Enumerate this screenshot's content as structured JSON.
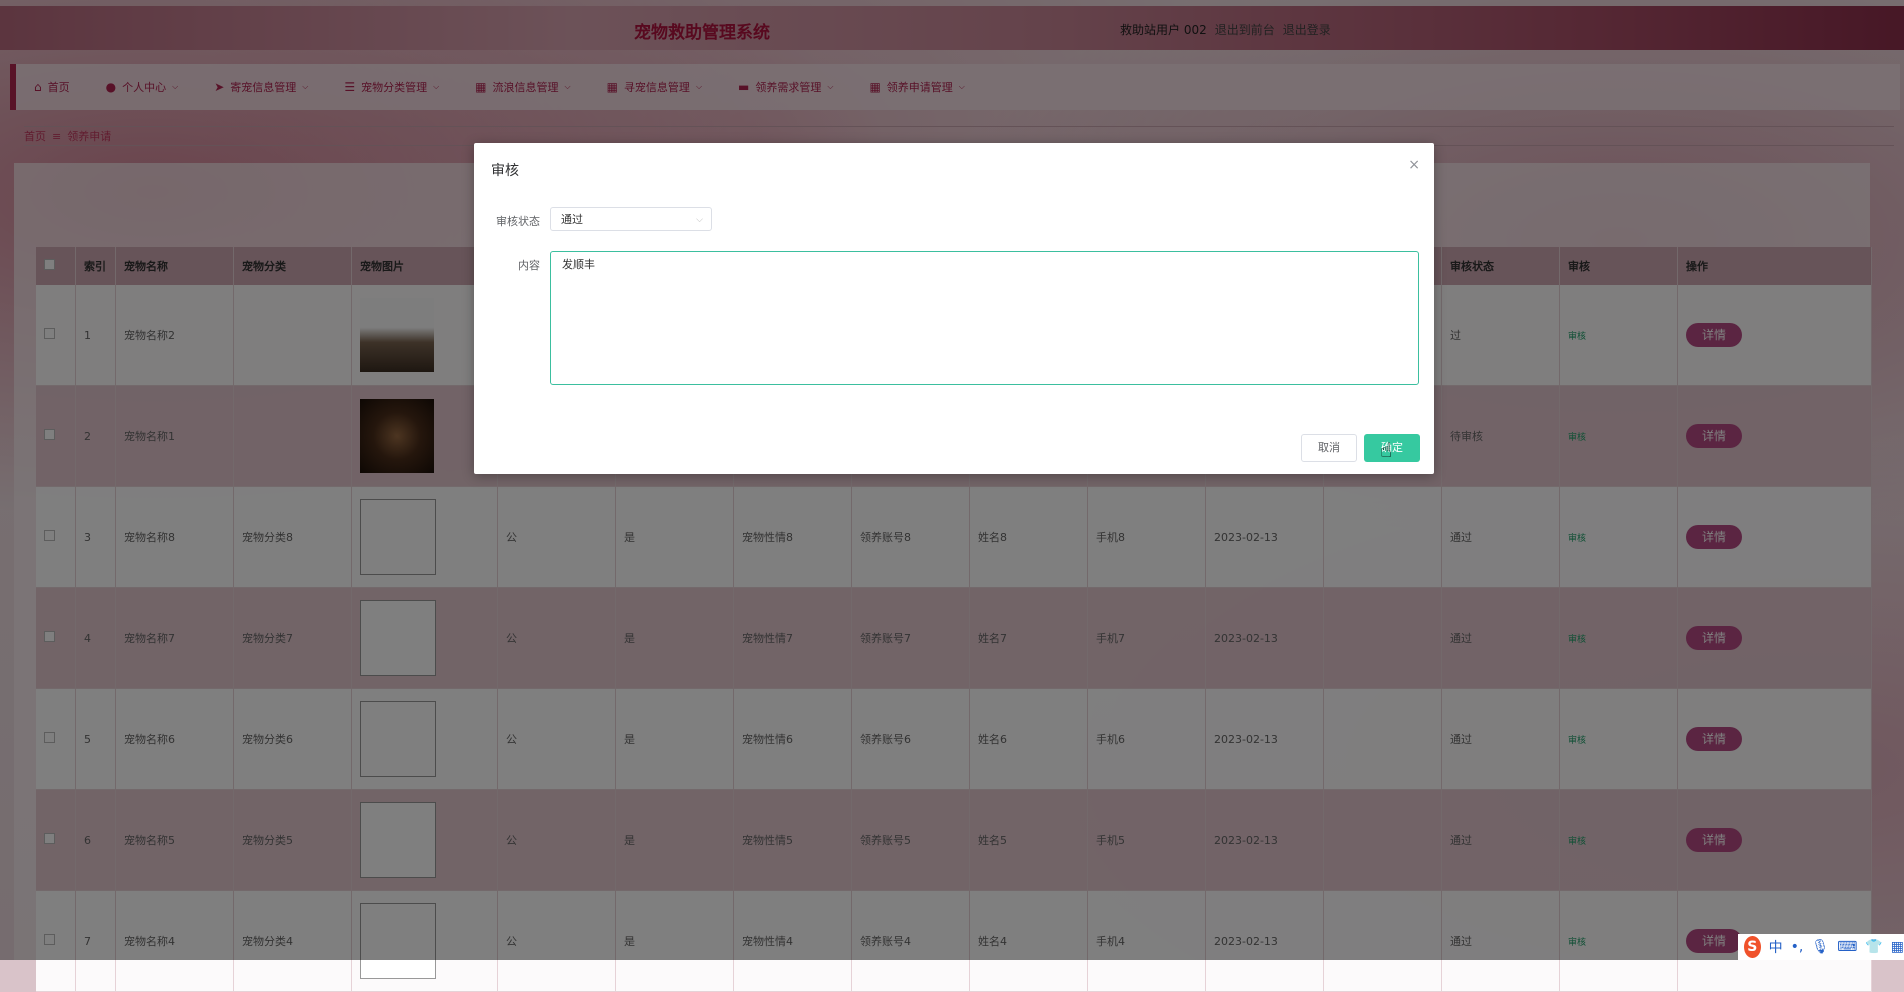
{
  "header": {
    "title": "宠物救助管理系统",
    "user": "救助站用户 002",
    "to_front": "退出到前台",
    "logout": "退出登录"
  },
  "nav": [
    {
      "label": "首页",
      "icon": "home-icon",
      "glyph": "⌂",
      "has_menu": false
    },
    {
      "label": "个人中心",
      "icon": "user-icon",
      "glyph": "●",
      "has_menu": true
    },
    {
      "label": "寄宠信息管理",
      "icon": "send-icon",
      "glyph": "➤",
      "has_menu": true
    },
    {
      "label": "宠物分类管理",
      "icon": "list-icon",
      "glyph": "☰",
      "has_menu": true
    },
    {
      "label": "流浪信息管理",
      "icon": "grid-icon",
      "glyph": "▦",
      "has_menu": true
    },
    {
      "label": "寻宠信息管理",
      "icon": "grid-icon",
      "glyph": "▦",
      "has_menu": true
    },
    {
      "label": "领养需求管理",
      "icon": "message-icon",
      "glyph": "▬",
      "has_menu": true
    },
    {
      "label": "领养申请管理",
      "icon": "grid-icon",
      "glyph": "▦",
      "has_menu": true
    }
  ],
  "breadcrumb": {
    "home": "首页",
    "current": "领养申请"
  },
  "table": {
    "headers": [
      "索引",
      "宠物名称",
      "宠物分类",
      "宠物图片",
      "审核状态",
      "审核",
      "操作"
    ],
    "rows": [
      {
        "index": "1",
        "name": "宠物名称2",
        "category": "",
        "gender": "",
        "vaccine": "",
        "character": "",
        "account": "",
        "realname": "",
        "phone": "",
        "date": "",
        "status": "过",
        "review": "审核",
        "action": "详情",
        "photo": "photo1"
      },
      {
        "index": "2",
        "name": "宠物名称1",
        "category": "",
        "gender": "",
        "vaccine": "",
        "character": "",
        "account": "",
        "realname": "",
        "phone": "",
        "date": "",
        "status": "待审核",
        "review": "审核",
        "action": "详情",
        "photo": "photo2"
      },
      {
        "index": "3",
        "name": "宠物名称8",
        "category": "宠物分类8",
        "gender": "公",
        "vaccine": "是",
        "character": "宠物性情8",
        "account": "领养账号8",
        "realname": "姓名8",
        "phone": "手机8",
        "date": "2023-02-13",
        "status": "通过",
        "review": "审核",
        "action": "详情",
        "photo": "broken"
      },
      {
        "index": "4",
        "name": "宠物名称7",
        "category": "宠物分类7",
        "gender": "公",
        "vaccine": "是",
        "character": "宠物性情7",
        "account": "领养账号7",
        "realname": "姓名7",
        "phone": "手机7",
        "date": "2023-02-13",
        "status": "通过",
        "review": "审核",
        "action": "详情",
        "photo": "broken"
      },
      {
        "index": "5",
        "name": "宠物名称6",
        "category": "宠物分类6",
        "gender": "公",
        "vaccine": "是",
        "character": "宠物性情6",
        "account": "领养账号6",
        "realname": "姓名6",
        "phone": "手机6",
        "date": "2023-02-13",
        "status": "通过",
        "review": "审核",
        "action": "详情",
        "photo": "broken"
      },
      {
        "index": "6",
        "name": "宠物名称5",
        "category": "宠物分类5",
        "gender": "公",
        "vaccine": "是",
        "character": "宠物性情5",
        "account": "领养账号5",
        "realname": "姓名5",
        "phone": "手机5",
        "date": "2023-02-13",
        "status": "通过",
        "review": "审核",
        "action": "详情",
        "photo": "broken"
      },
      {
        "index": "7",
        "name": "宠物名称4",
        "category": "宠物分类4",
        "gender": "公",
        "vaccine": "是",
        "character": "宠物性情4",
        "account": "领养账号4",
        "realname": "姓名4",
        "phone": "手机4",
        "date": "2023-02-13",
        "status": "通过",
        "review": "审核",
        "action": "详情",
        "photo": "broken"
      }
    ]
  },
  "dialog": {
    "title": "审核",
    "close": "×",
    "status_label": "审核状态",
    "status_value": "通过",
    "content_label": "内容",
    "content_value": "发顺丰",
    "cancel": "取消",
    "ok": "确定"
  },
  "ime": {
    "logo": "S",
    "lang": "中",
    "punct": "•,"
  },
  "colors": {
    "accent": "#b02350",
    "ok_button": "#36c9a0",
    "detail_button": "#b74b84"
  }
}
